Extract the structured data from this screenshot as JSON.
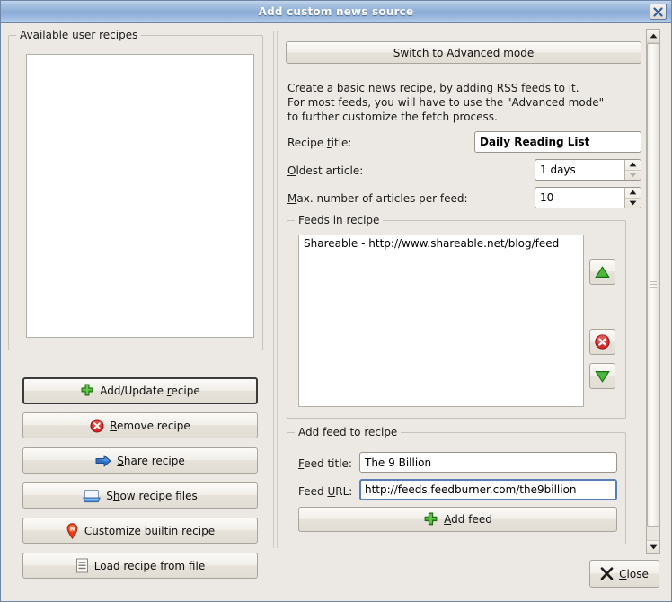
{
  "window": {
    "title": "Add custom news source",
    "close_icon": "window-close-icon",
    "bg_color": "#ece9e4",
    "title_bar_color": "#8cacd6"
  },
  "left_panel": {
    "group_title": "Available user recipes",
    "recipes": [],
    "buttons": [
      {
        "id": "add-update-recipe",
        "label_before": "Add/Update ",
        "accel": "r",
        "label_after": "ecipe",
        "icon": "green-plus-icon",
        "is_default": true
      },
      {
        "id": "remove-recipe",
        "label_before": "",
        "accel": "R",
        "label_after": "emove recipe",
        "icon": "red-x-circle-icon",
        "is_default": false
      },
      {
        "id": "share-recipe",
        "label_before": "",
        "accel": "S",
        "label_after": "hare recipe",
        "icon": "blue-right-arrow-icon",
        "is_default": false
      },
      {
        "id": "show-recipe-files",
        "label_before": "S",
        "accel": "h",
        "label_after": "ow recipe files",
        "icon": "folder-open-icon",
        "is_default": false
      },
      {
        "id": "customize-builtin-recipe",
        "label_before": "Customize ",
        "accel": "b",
        "label_after": "uiltin recipe",
        "icon": "news-pin-icon",
        "is_default": false
      },
      {
        "id": "load-recipe-from-file",
        "label_before": "",
        "accel": "L",
        "label_after": "oad recipe from file",
        "icon": "document-lines-icon",
        "is_default": false
      }
    ]
  },
  "right_panel": {
    "switch_mode_button": "Switch to Advanced mode",
    "description": "Create a basic news recipe, by adding RSS feeds to it.\nFor most feeds, you will have to use the \"Advanced mode\"\nto further customize the fetch process.",
    "recipe_title": {
      "label_before": "Recipe ",
      "accel": "t",
      "label_after": "itle:",
      "value": "Daily Reading List"
    },
    "oldest_article": {
      "accel": "O",
      "label_after": "ldest article:",
      "value": "1 days",
      "up_icon": "spinner-up-icon",
      "down_icon": "spinner-down-icon",
      "down_disabled": true
    },
    "max_articles": {
      "accel": "M",
      "label_after": "ax. number of articles per feed:",
      "value": "10",
      "up_icon": "spinner-up-icon",
      "down_icon": "spinner-down-icon",
      "down_disabled": false
    },
    "feeds_group": {
      "title": "Feeds in recipe",
      "items": [
        "Shareable - http://www.shareable.net/blog/feed"
      ],
      "side_buttons": [
        {
          "id": "move-feed-up",
          "icon": "green-up-triangle-icon"
        },
        {
          "id": "remove-feed",
          "icon": "red-x-circle-icon"
        },
        {
          "id": "move-feed-down",
          "icon": "green-down-triangle-icon"
        }
      ]
    },
    "add_feed_group": {
      "title": "Add feed to recipe",
      "feed_title": {
        "accel": "F",
        "label_after": "eed title:",
        "value": "The 9 Billion",
        "focused": false
      },
      "feed_url": {
        "label_before": "Feed ",
        "accel": "U",
        "label_after": "RL:",
        "value": "http://feeds.feedburner.com/the9billion",
        "focused": true
      },
      "add_button": {
        "label_before": "",
        "accel": "A",
        "label_after": "dd feed",
        "icon": "green-plus-icon"
      }
    }
  },
  "scrollbar": {
    "up_icon": "scroll-up-icon",
    "down_icon": "scroll-down-icon",
    "grip_icon": "scroll-grip-icon"
  },
  "footer": {
    "close_button": {
      "label_before": "",
      "accel": "C",
      "label_after": "lose",
      "icon": "black-x-icon"
    }
  }
}
